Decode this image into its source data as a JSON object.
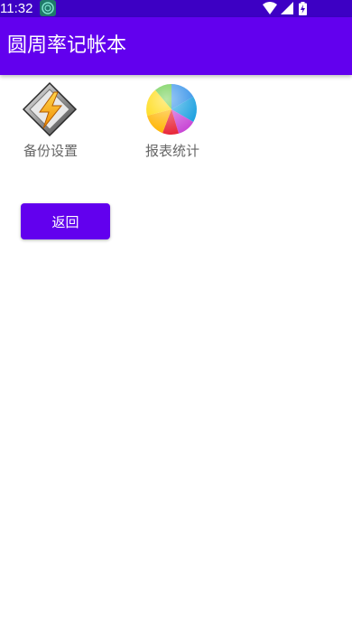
{
  "status_bar": {
    "time": "11:32",
    "icons": [
      "app-notification-icon",
      "wifi-icon",
      "cell-signal-icon",
      "battery-charging-icon"
    ]
  },
  "app_bar": {
    "title": "圆周率记帐本"
  },
  "tiles": [
    {
      "label": "备份设置",
      "icon": "lightning-icon"
    },
    {
      "label": "报表统计",
      "icon": "pie-chart-icon"
    }
  ],
  "back_button": {
    "label": "返回"
  },
  "colors": {
    "status_bar": "#3d00c4",
    "primary": "#6200ee",
    "label_text": "#666666",
    "background": "#ffffff"
  }
}
